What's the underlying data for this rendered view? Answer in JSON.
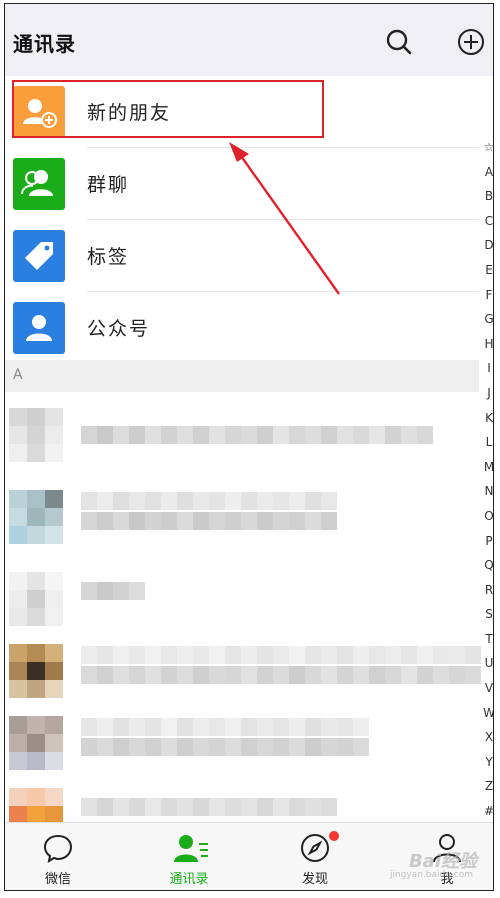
{
  "header": {
    "title": "通讯录"
  },
  "menu": [
    {
      "label": "新的朋友",
      "icon": "add-friend-icon",
      "color": "#fa9d3b"
    },
    {
      "label": "群聊",
      "icon": "group-chat-icon",
      "color": "#1aad19"
    },
    {
      "label": "标签",
      "icon": "tag-icon",
      "color": "#2b7fe0"
    },
    {
      "label": "公众号",
      "icon": "official-account-icon",
      "color": "#2b7fe0"
    }
  ],
  "section": {
    "letter": "A"
  },
  "index_letters": [
    "☆",
    "A",
    "B",
    "C",
    "D",
    "E",
    "F",
    "G",
    "H",
    "I",
    "J",
    "K",
    "L",
    "M",
    "N",
    "O",
    "P",
    "Q",
    "R",
    "S",
    "T",
    "U",
    "V",
    "W",
    "X",
    "Y",
    "Z",
    "#"
  ],
  "tabs": [
    {
      "label": "微信",
      "icon": "chat-bubble-icon"
    },
    {
      "label": "通讯录",
      "icon": "contacts-icon",
      "active": true
    },
    {
      "label": "发现",
      "icon": "compass-icon"
    },
    {
      "label": "我",
      "icon": "person-icon"
    }
  ],
  "watermark": {
    "text": "Bai经验",
    "sub": "jingyan.baidu.com"
  },
  "colors": {
    "accent": "#1aad19",
    "highlight_box": "#e0232b",
    "badge": "#f43530"
  }
}
